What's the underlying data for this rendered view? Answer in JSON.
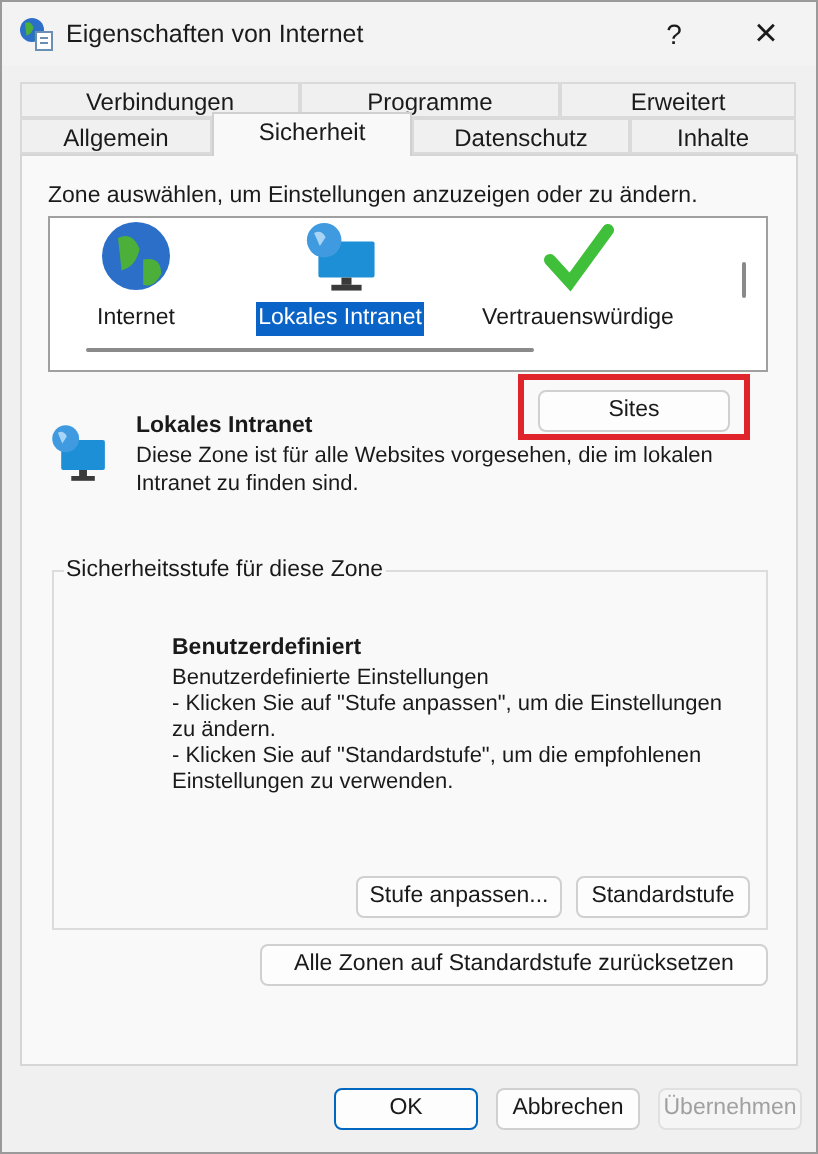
{
  "window": {
    "title": "Eigenschaften von Internet",
    "help": "?",
    "close": "×"
  },
  "tab_rows": [
    [
      {
        "label": "Verbindungen",
        "selected": false
      },
      {
        "label": "Programme",
        "selected": false
      },
      {
        "label": "Erweitert",
        "selected": false
      }
    ],
    [
      {
        "label": "Allgemein",
        "selected": false
      },
      {
        "label": "Sicherheit",
        "selected": true
      },
      {
        "label": "Datenschutz",
        "selected": false
      },
      {
        "label": "Inhalte",
        "selected": false
      }
    ]
  ],
  "zone_prompt": "Zone auswählen, um Einstellungen anzuzeigen oder zu ändern.",
  "zones": [
    {
      "kind": "globe",
      "label": "Internet",
      "selected": false
    },
    {
      "kind": "monitor",
      "label": "Lokales Intranet",
      "selected": true
    },
    {
      "kind": "check",
      "label": "Vertrauenswürdige",
      "selected": false
    }
  ],
  "zone_info": {
    "title": "Lokales Intranet",
    "description": "Diese Zone ist für alle Websites vorgesehen, die im lokalen Intranet zu finden sind."
  },
  "sites_button": {
    "label": "Sites",
    "highlighted": true
  },
  "security_level": {
    "legend": "Sicherheitsstufe für diese Zone",
    "title": "Benutzerdefiniert",
    "lines": [
      "Benutzerdefinierte Einstellungen",
      "- Klicken Sie auf \"Stufe anpassen\", um die Einstellungen zu ändern.",
      "- Klicken Sie auf \"Standardstufe\", um die empfohlenen Einstellungen zu verwenden."
    ],
    "buttons": [
      "Stufe anpassen...",
      "Standardstufe"
    ]
  },
  "reset_button": "Alle Zonen auf Standardstufe zurücksetzen",
  "dialog_buttons": [
    {
      "label": "OK",
      "default": true,
      "disabled": false
    },
    {
      "label": "Abbrechen",
      "default": false,
      "disabled": false
    },
    {
      "label": "Übernehmen",
      "default": false,
      "disabled": true
    }
  ]
}
